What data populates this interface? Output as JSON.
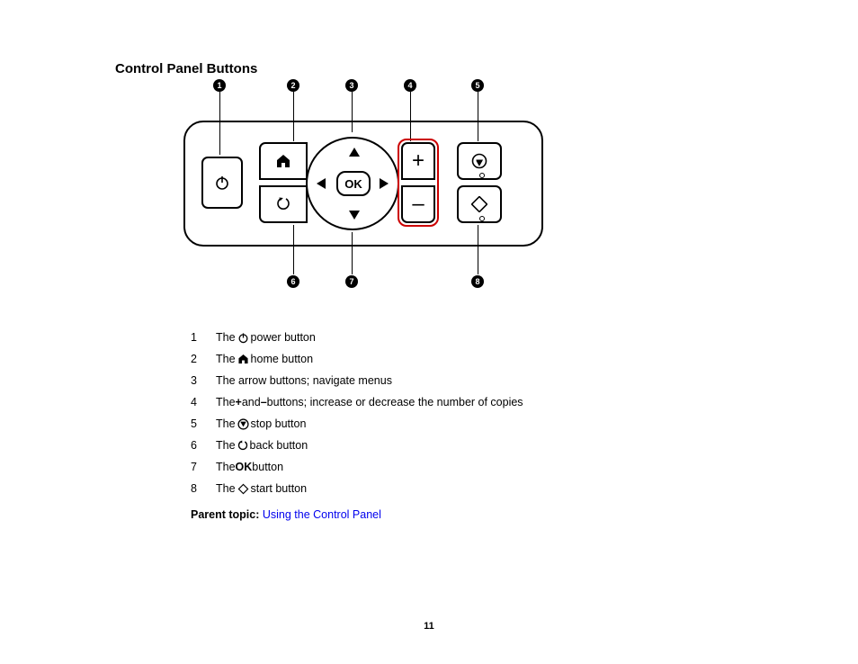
{
  "heading": "Control Panel Buttons",
  "callouts_top": [
    "1",
    "2",
    "3",
    "4",
    "5"
  ],
  "callouts_bottom": [
    "6",
    "7",
    "8"
  ],
  "ok_label": "OK",
  "plus_label": "+",
  "minus_label": "–",
  "legend": [
    {
      "n": "1",
      "pre": "The ",
      "icon": "power",
      "post": " power button"
    },
    {
      "n": "2",
      "pre": "The ",
      "icon": "home",
      "post": " home button"
    },
    {
      "n": "3",
      "pre": "The arrow buttons; navigate menus",
      "icon": "",
      "post": ""
    },
    {
      "n": "4",
      "pre": "The ",
      "bold": "+",
      "mid": " and ",
      "bold2": "–",
      "post": " buttons; increase or decrease the number of copies"
    },
    {
      "n": "5",
      "pre": "The ",
      "icon": "stop",
      "post": " stop button"
    },
    {
      "n": "6",
      "pre": "The ",
      "icon": "back",
      "post": " back button"
    },
    {
      "n": "7",
      "pre": "The ",
      "bold": "OK",
      "post": " button"
    },
    {
      "n": "8",
      "pre": "The ",
      "icon": "start",
      "post": " start button"
    }
  ],
  "parent_topic_label": "Parent topic: ",
  "parent_topic_link": "Using the Control Panel",
  "page_number": "11"
}
